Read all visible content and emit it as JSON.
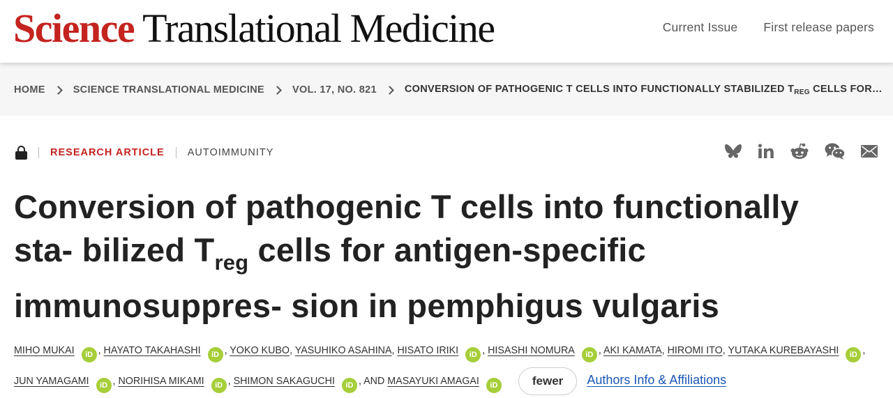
{
  "header": {
    "logo_science": "Science",
    "logo_rest": "Translational Medicine",
    "nav": [
      "Current Issue",
      "First release papers"
    ]
  },
  "breadcrumb": {
    "items": [
      "HOME",
      "SCIENCE TRANSLATIONAL MEDICINE",
      "VOL. 17, NO. 821"
    ],
    "current_pre": "CONVERSION OF PATHOGENIC T CELLS INTO FUNCTIONALLY STABILIZED T",
    "current_sub": "REG",
    "current_post": " CELLS FOR…"
  },
  "article": {
    "type": "RESEARCH ARTICLE",
    "subject": "AUTOIMMUNITY",
    "title_pre": "Conversion of pathogenic T cells into functionally sta- bilized T",
    "title_sub": "reg",
    "title_post": " cells for antigen-specific immunosuppres- sion in pemphigus vulgaris"
  },
  "share_icons": [
    "bluesky-icon",
    "linkedin-icon",
    "reddit-icon",
    "wechat-icon",
    "email-icon"
  ],
  "authors": {
    "list": [
      {
        "name": "MIHO MUKAI",
        "orcid": true
      },
      {
        "name": "HAYATO TAKAHASHI",
        "orcid": true
      },
      {
        "name": "YOKO KUBO",
        "orcid": false
      },
      {
        "name": "YASUHIKO ASAHINA",
        "orcid": false
      },
      {
        "name": "HISATO IRIKI",
        "orcid": true
      },
      {
        "name": "HISASHI NOMURA",
        "orcid": true
      },
      {
        "name": "AKI KAMATA",
        "orcid": false
      },
      {
        "name": "HIROMI ITO",
        "orcid": false
      },
      {
        "name": "YUTAKA KUREBAYASHI",
        "orcid": true
      },
      {
        "name": "JUN YAMAGAMI",
        "orcid": true
      },
      {
        "name": "NORIHISA MIKAMI",
        "orcid": true
      },
      {
        "name": "SHIMON SAKAGUCHI",
        "orcid": true
      },
      {
        "name": "MASAYUKI AMAGAI",
        "orcid": true
      }
    ],
    "and_label": "AND",
    "orcid_glyph": "iD",
    "fewer_label": "fewer",
    "affiliations_label": "Authors Info & Affiliations"
  },
  "colors": {
    "brand_red": "#c4231f",
    "orcid_green": "#a6ce39",
    "link_blue": "#1a56b8"
  }
}
